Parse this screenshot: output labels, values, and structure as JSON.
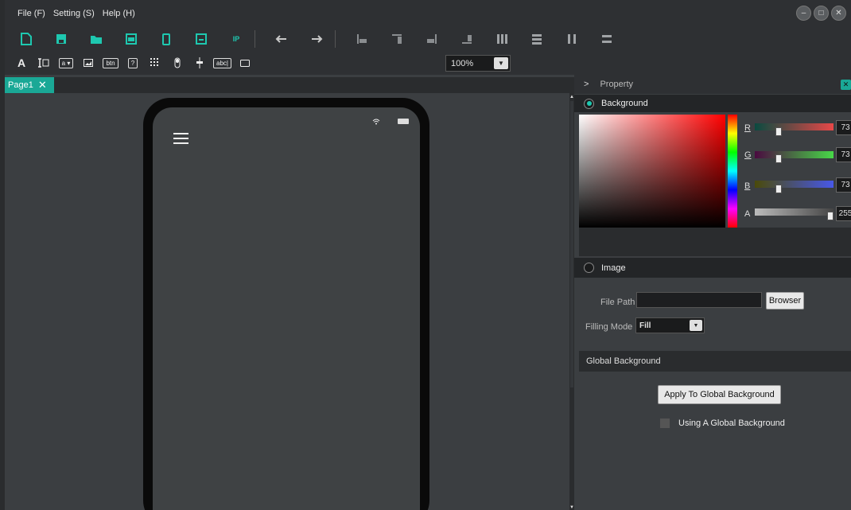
{
  "menubar": {
    "items": [
      "File (F)",
      "Setting (S)",
      "Help (H)"
    ]
  },
  "window_controls": {
    "minimize": "–",
    "maximize": "□",
    "close": "✕"
  },
  "toolbar1": {
    "ip_label": "IP"
  },
  "toolbar2": {
    "text_tool": "A",
    "dropdown_tool": "a ▾",
    "button_tool": "btn",
    "question_tool": "?",
    "input_tool": "abc|"
  },
  "zoom": {
    "value": "100%"
  },
  "tabs": [
    {
      "label": "Page1",
      "close": "✕"
    }
  ],
  "property_panel": {
    "title": "Property",
    "background_section": "Background",
    "image_section": "Image",
    "colors": {
      "r": {
        "label": "R",
        "value": "73",
        "level": 73
      },
      "g": {
        "label": "G",
        "value": "73",
        "level": 73
      },
      "b": {
        "label": "B",
        "value": "73",
        "level": 73
      },
      "a": {
        "label": "A",
        "value": "255",
        "level": 255
      }
    },
    "file_path_label": "File Path",
    "file_path_value": "",
    "browser_button": "Browser",
    "filling_mode_label": "Filling Mode",
    "filling_mode_value": "Fill",
    "global_bg_title": "Global Background",
    "apply_button": "Apply To Global Background",
    "using_global_label": "Using A Global Background"
  },
  "accent_color": "#1aa896"
}
